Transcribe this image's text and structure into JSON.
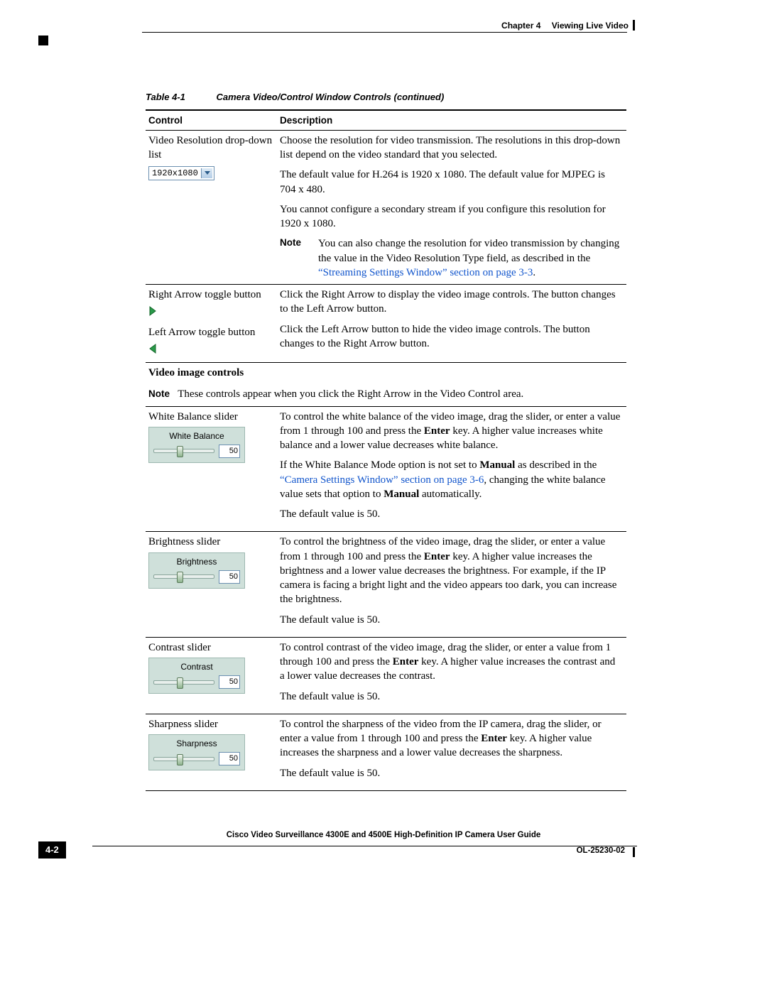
{
  "header": {
    "chapter": "Chapter 4",
    "title": "Viewing Live Video"
  },
  "table_caption": {
    "num": "Table 4-1",
    "text": "Camera Video/Control Window Controls (continued)"
  },
  "columns": {
    "control": "Control",
    "description": "Description"
  },
  "rows": {
    "video_res": {
      "ctrl_line1": "Video Resolution drop-down list",
      "dropdown_value": "1920x1080",
      "p1": "Choose the resolution for video transmission. The resolutions in this drop-down list depend on the video standard that you selected.",
      "p2": "The default value for H.264 is 1920 x 1080. The default value for MJPEG is 704 x 480.",
      "p3": "You cannot configure a secondary stream if you configure this resolution for 1920 x 1080.",
      "note_label": "Note",
      "note_text_a": "You can also change the resolution for video transmission by changing the value in the Video Resolution Type field, as described in the ",
      "note_link": "“Streaming Settings Window” section on page 3-3",
      "note_text_b": "."
    },
    "arrows": {
      "ctrl_r": "Right Arrow toggle button",
      "ctrl_l": "Left Arrow toggle button",
      "p1": "Click the Right Arrow to display the video image controls. The button changes to the Left Arrow button.",
      "p2": "Click the Left Arrow button to hide the video image controls. The button changes to the Right Arrow button."
    },
    "section": {
      "title": "Video image controls",
      "note_label": "Note",
      "note_text": "These controls appear when you click the Right Arrow in the Video Control area."
    },
    "wb": {
      "ctrl": "White Balance slider",
      "sw_label": "White Balance",
      "sw_val": "50",
      "p1a": "To control the white balance of the video image, drag the slider, or enter a value from 1 through 100 and press the ",
      "enter": "Enter",
      "p1b": " key. A higher value increases white balance and a lower value decreases white balance.",
      "p2a": "If the White Balance Mode option is not set to ",
      "manual": "Manual",
      "p2b": " as described in the ",
      "link": "“Camera Settings Window” section on page 3-6",
      "p2c": ", changing the white balance value sets that option to ",
      "p2d": " automatically.",
      "p3": "The default value is 50."
    },
    "bright": {
      "ctrl": "Brightness slider",
      "sw_label": "Brightness",
      "sw_val": "50",
      "p1a": "To control the brightness of the video image, drag the slider, or enter a value from 1 through 100 and press the ",
      "enter": "Enter",
      "p1b": " key. A higher value increases the brightness and a lower value decreases the brightness. For example, if the IP camera is facing a bright light and the video appears too dark, you can increase the brightness.",
      "p2": "The default value is 50."
    },
    "contrast": {
      "ctrl": "Contrast slider",
      "sw_label": "Contrast",
      "sw_val": "50",
      "p1a": "To control contrast of the video image, drag the slider, or enter a value from 1 through 100 and press the ",
      "enter": "Enter",
      "p1b": " key. A higher value increases the contrast and a lower value decreases the contrast.",
      "p2": "The default value is 50."
    },
    "sharp": {
      "ctrl": "Sharpness slider",
      "sw_label": "Sharpness",
      "sw_val": "50",
      "p1a": "To control the sharpness of the video from the IP camera, drag the slider, or enter a value from 1 through 100 and press the ",
      "enter": "Enter",
      "p1b": " key. A higher value increases the sharpness and a lower value decreases the sharpness.",
      "p2": "The default value is 50."
    }
  },
  "footer": {
    "guide": "Cisco Video Surveillance 4300E and 4500E High-Definition IP Camera User Guide",
    "page": "4-2",
    "docid": "OL-25230-02"
  }
}
